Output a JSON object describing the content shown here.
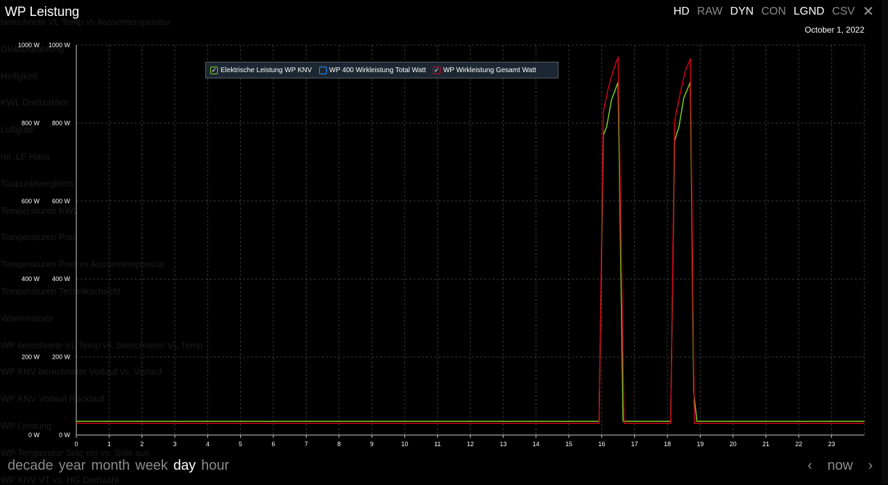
{
  "window": {
    "title": "WP Leistung",
    "date": "October 1, 2022",
    "toolbar": [
      {
        "label": "HD",
        "active": true
      },
      {
        "label": "RAW",
        "active": false
      },
      {
        "label": "DYN",
        "active": true
      },
      {
        "label": "CON",
        "active": false
      },
      {
        "label": "LGND",
        "active": true
      },
      {
        "label": "CSV",
        "active": false
      }
    ],
    "close_symbol": "✕"
  },
  "background_list": [
    "berechnete VL Temp vs Aussentemperatur",
    "Globalstrahlung",
    "Helligkeit",
    "KWL Drehzahlen",
    "Luftgüte",
    "rel. LF Haus",
    "Taupunktvergleich",
    "Temperaturen KWL",
    "Temperaturen Pool",
    "Temperaturen Pool vs Aussentemperatur",
    "Temperaturen Technikschacht",
    "Warmwasser",
    "WP berechnete VL Temp vs. berechneter VL Temp",
    "WP KNV berechneter Vorlauf vs. Vorlauf",
    "WP KNV Vorlauf Rücklauf",
    "WP Leistung",
    "WP Temperatur Sole ein vs. Sole aus",
    "WP KNV VT vs. HG Drehzahl"
  ],
  "ranges": {
    "items": [
      "decade",
      "year",
      "month",
      "week",
      "day",
      "hour"
    ],
    "active": "day"
  },
  "nav": {
    "prev": "‹",
    "now": "now",
    "next": "›"
  },
  "chart_data": {
    "type": "line",
    "x_range": [
      0,
      24
    ],
    "y_range": [
      0,
      1000
    ],
    "y_ticks": [
      {
        "value": 0,
        "left": "0 W",
        "right": "0 W"
      },
      {
        "value": 200,
        "left": "200 W",
        "right": "200 W"
      },
      {
        "value": 400,
        "left": "400 W",
        "right": "400 W"
      },
      {
        "value": 600,
        "left": "600 W",
        "right": "600 W"
      },
      {
        "value": 800,
        "left": "800 W",
        "right": "800 W"
      },
      {
        "value": 1000,
        "left": "1000 W",
        "right": "1000 W"
      }
    ],
    "x_ticks": [
      "0",
      "1",
      "2",
      "3",
      "4",
      "5",
      "6",
      "7",
      "8",
      "9",
      "10",
      "11",
      "12",
      "13",
      "14",
      "15",
      "16",
      "17",
      "18",
      "19",
      "20",
      "21",
      "22",
      "23"
    ],
    "grid": true,
    "legend": {
      "placement": "top-left"
    },
    "series": [
      {
        "name": "Elektrische Leistung WP KNV",
        "color": "#7ed321",
        "checked": true,
        "points": [
          [
            0,
            35
          ],
          [
            15.92,
            35
          ],
          [
            16.05,
            770
          ],
          [
            16.15,
            790
          ],
          [
            16.3,
            860
          ],
          [
            16.5,
            905
          ],
          [
            16.65,
            35
          ],
          [
            18.1,
            35
          ],
          [
            18.22,
            755
          ],
          [
            18.35,
            790
          ],
          [
            18.5,
            865
          ],
          [
            18.7,
            905
          ],
          [
            18.8,
            110
          ],
          [
            18.9,
            35
          ],
          [
            24,
            35
          ]
        ]
      },
      {
        "name": "WP 400 Wirkleistung Total Watt",
        "color": "#1e90ff",
        "checked": false,
        "points": []
      },
      {
        "name": "WP Wirkleistung Gesamt Watt",
        "color": "#d0021b",
        "checked": true,
        "points": [
          [
            0,
            30
          ],
          [
            15.92,
            30
          ],
          [
            16.05,
            830
          ],
          [
            16.2,
            890
          ],
          [
            16.35,
            935
          ],
          [
            16.5,
            970
          ],
          [
            16.68,
            30
          ],
          [
            18.1,
            30
          ],
          [
            18.22,
            805
          ],
          [
            18.4,
            880
          ],
          [
            18.55,
            935
          ],
          [
            18.7,
            965
          ],
          [
            18.82,
            30
          ],
          [
            24,
            30
          ]
        ]
      }
    ]
  }
}
